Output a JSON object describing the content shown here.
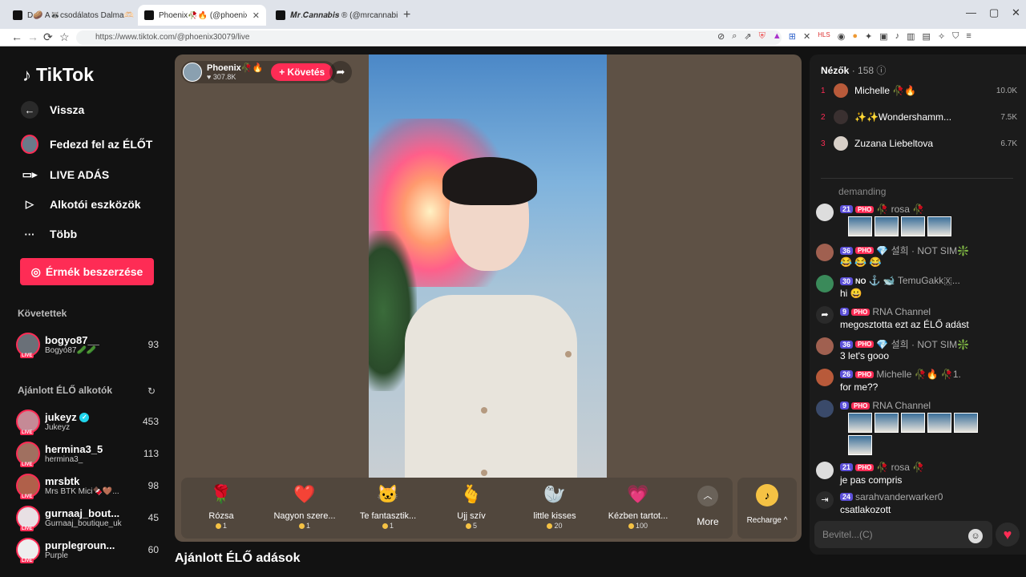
{
  "browser": {
    "tabs": [
      {
        "title": "D🥔 A🦝csodálatos Dalma🫶🏻 (@..."
      },
      {
        "title": "Phoenix🥀🔥 (@phoenix3007..."
      },
      {
        "title": "𝑴𝒓.𝑪𝒂𝒏𝒏𝒂𝒃𝒊𝒔 ® (@mrcannabis_)..."
      }
    ],
    "new_tab": "+",
    "url": "https://www.tiktok.com/@phoenix30079/live"
  },
  "sidebar": {
    "logo": "TikTok",
    "nav": [
      {
        "label": "Vissza",
        "icon": "back-arrow-icon"
      },
      {
        "label": "Fedezd fel az ÉLŐT",
        "icon": "explore-live-avatar"
      },
      {
        "label": "LIVE ADÁS",
        "icon": "video-camera-icon"
      },
      {
        "label": "Alkotói eszközök",
        "icon": "creator-tools-icon"
      },
      {
        "label": "Több",
        "icon": "more-dots-icon"
      }
    ],
    "coins_button": "Érmék beszerzése",
    "followed_title": "Követettek",
    "followed": [
      {
        "name": "bogyo87__",
        "sub": "Bogyó87🥒🥒",
        "count": "93"
      }
    ],
    "recommended_title": "Ajánlott ÉLŐ alkotók",
    "recommended": [
      {
        "name": "jukeyz",
        "sub": "Jukeyz",
        "count": "453",
        "verified": true
      },
      {
        "name": "hermina3_5",
        "sub": "hermina3_",
        "count": "113"
      },
      {
        "name": "mrsbtk",
        "sub": "Mrs BTK Mici🍫🤎...",
        "count": "98"
      },
      {
        "name": "gurnaaj_bout...",
        "sub": "Gurnaaj_boutique_uk",
        "count": "45"
      },
      {
        "name": "purplegroun...",
        "sub": "Purple",
        "count": "60"
      }
    ]
  },
  "stream": {
    "host_name": "Phoenix🥀🔥",
    "host_likes": "307.8K",
    "follow_label": "+ Követés",
    "gifts": [
      {
        "name": "Rózsa",
        "price": "1",
        "emoji": "🌹"
      },
      {
        "name": "Nagyon szere...",
        "price": "1",
        "emoji": "❤️"
      },
      {
        "name": "Te fantasztik...",
        "price": "1",
        "emoji": "🐱"
      },
      {
        "name": "Ujj szív",
        "price": "5",
        "emoji": "🫰"
      },
      {
        "name": "little kisses",
        "price": "20",
        "emoji": "🦭"
      },
      {
        "name": "Kézben tartot...",
        "price": "100",
        "emoji": "💗"
      }
    ],
    "more_label": "More",
    "recharge_label": "Recharge ^",
    "below_title": "Ajánlott ÉLŐ adások"
  },
  "chat": {
    "viewers_label": "Nézők",
    "viewers_count": "· 158",
    "top_viewers": [
      {
        "rank": "1",
        "name": "Michelle 🥀🔥",
        "score": "10.0K"
      },
      {
        "rank": "2",
        "name": "✨✨Wondershamm...",
        "score": "7.5K"
      },
      {
        "rank": "3",
        "name": "Zuzana Liebeltova",
        "score": "6.7K"
      }
    ],
    "faded_text": "demanding",
    "messages": [
      {
        "level": "21",
        "fan": "PHO",
        "name": "🥀 rosa 🥀",
        "text": ""
      },
      {
        "level": "36",
        "fan": "PHO",
        "name": "💎 설희 · NOT SIM❇️",
        "text": "😂 😂 😂"
      },
      {
        "level": "30",
        "fan": "NO",
        "name": "⚓ 🐋 TemuGakk🇽...",
        "text": "hi 😀"
      },
      {
        "level": "9",
        "fan": "PHO",
        "name": "RNA Channel",
        "text": "megosztotta ezt az ÉLŐ adást"
      },
      {
        "level": "36",
        "fan": "PHO",
        "name": "💎 설희 · NOT SIM❇️",
        "text": "3 let's gooo"
      },
      {
        "level": "26",
        "fan": "PHO",
        "name": "Michelle 🥀🔥 🥀1.",
        "text": "for me??"
      },
      {
        "level": "9",
        "fan": "PHO",
        "name": "RNA Channel",
        "text": ""
      },
      {
        "level": "21",
        "fan": "PHO",
        "name": "🥀 rosa 🥀",
        "text": "je pas compris"
      },
      {
        "level": "24",
        "fan": "",
        "name": "sarahvanderwarker0",
        "text": "csatlakozott"
      }
    ],
    "input_placeholder": "Bevitel...(C)"
  }
}
